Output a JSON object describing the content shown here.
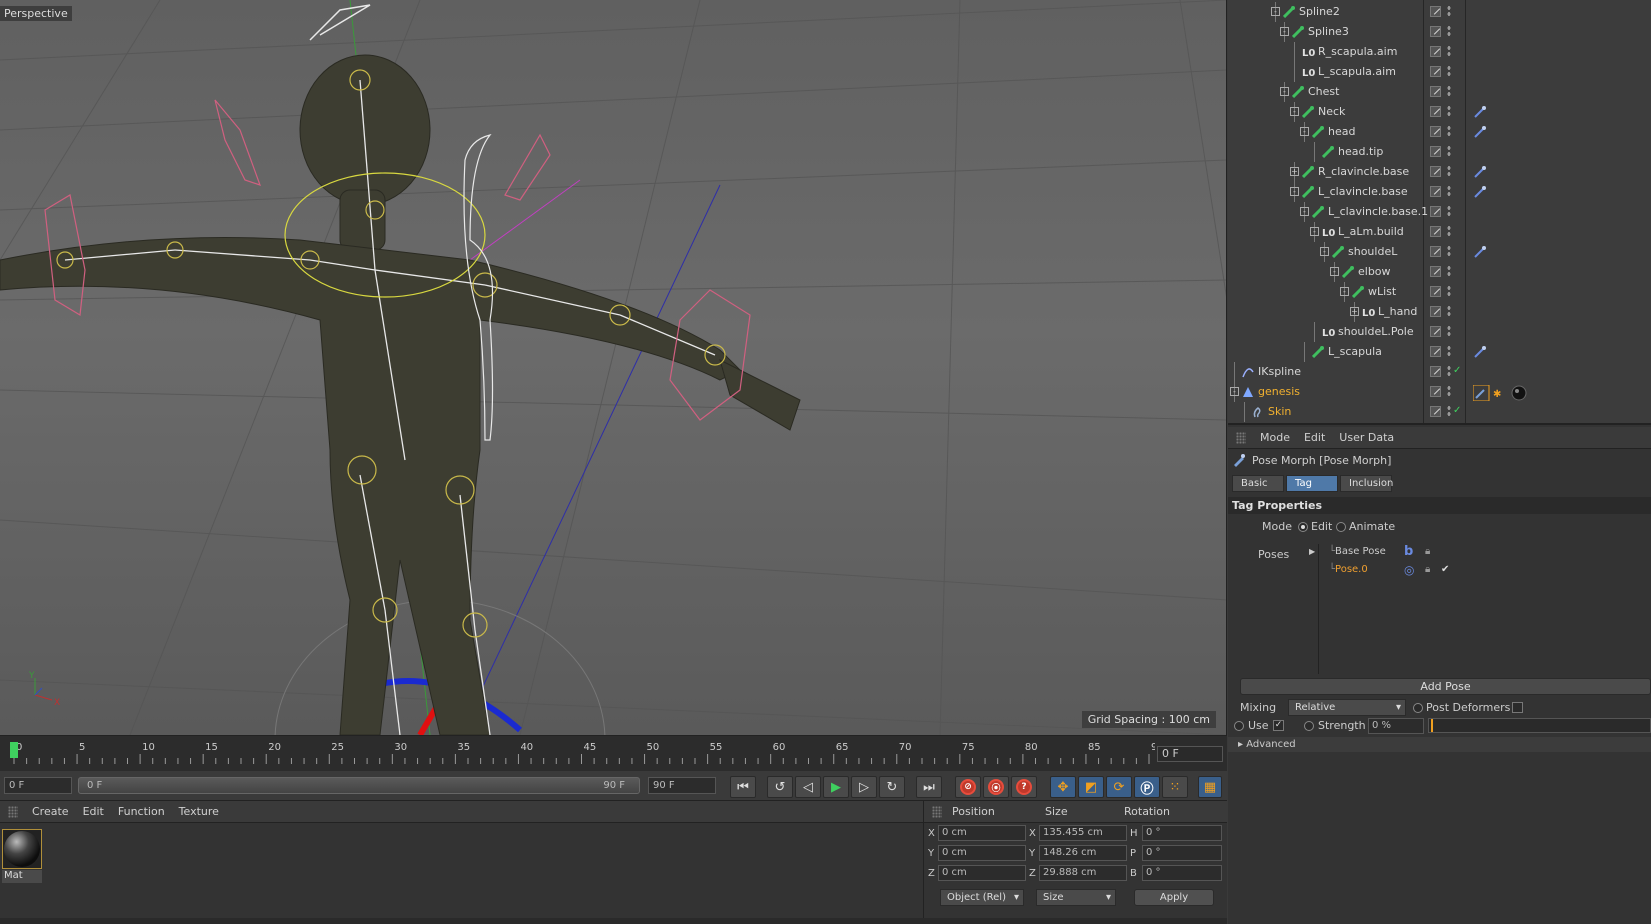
{
  "viewport": {
    "label": "Perspective",
    "grid_spacing": "Grid Spacing : 100 cm"
  },
  "timeline": {
    "ticks": [
      "0",
      "5",
      "10",
      "15",
      "20",
      "25",
      "30",
      "35",
      "40",
      "45",
      "50",
      "55",
      "60",
      "65",
      "70",
      "75",
      "80",
      "85",
      "90"
    ],
    "current_frame": "0 F"
  },
  "transport": {
    "start": "0 F",
    "range_start": "0 F",
    "range_end": "90 F",
    "end": "90 F"
  },
  "material_manager": {
    "menu": [
      "Create",
      "Edit",
      "Function",
      "Texture"
    ],
    "materials": [
      {
        "name": "Mat"
      }
    ]
  },
  "coordinates": {
    "headers": {
      "position": "Position",
      "size": "Size",
      "rotation": "Rotation"
    },
    "rows": [
      {
        "axis": "X",
        "pos": "0 cm",
        "size_axis": "X",
        "size": "135.455 cm",
        "rot_axis": "H",
        "rot": "0 °"
      },
      {
        "axis": "Y",
        "pos": "0 cm",
        "size_axis": "Y",
        "size": "148.26 cm",
        "rot_axis": "P",
        "rot": "0 °"
      },
      {
        "axis": "Z",
        "pos": "0 cm",
        "size_axis": "Z",
        "size": "29.888 cm",
        "rot_axis": "B",
        "rot": "0 °"
      }
    ],
    "mode": "Object (Rel)",
    "size_mode": "Size",
    "apply": "Apply"
  },
  "object_manager": {
    "items": [
      {
        "name": "Spline2",
        "icon": "bone",
        "expand": "-"
      },
      {
        "name": "Spline3",
        "icon": "bone",
        "expand": "-"
      },
      {
        "name": "R_scapula.aim",
        "icon": "null",
        "expand": ""
      },
      {
        "name": "L_scapula.aim",
        "icon": "null",
        "expand": ""
      },
      {
        "name": "Chest",
        "icon": "bone",
        "expand": "-"
      },
      {
        "name": "Neck",
        "icon": "bone",
        "expand": "-",
        "tag": "pose"
      },
      {
        "name": "head",
        "icon": "bone",
        "expand": "-",
        "tag": "pose"
      },
      {
        "name": "head.tip",
        "icon": "bone",
        "expand": ""
      },
      {
        "name": "R_clavincle.base",
        "icon": "bone",
        "expand": "+",
        "tag": "pose"
      },
      {
        "name": "L_clavincle.base",
        "icon": "bone",
        "expand": "-",
        "tag": "pose"
      },
      {
        "name": "L_clavincle.base.1",
        "icon": "bone",
        "expand": "-"
      },
      {
        "name": "L_aLm.build",
        "icon": "null",
        "expand": "-"
      },
      {
        "name": "shouldeL",
        "icon": "bone",
        "expand": "-",
        "tag": "pose"
      },
      {
        "name": "elbow",
        "icon": "bone",
        "expand": "-"
      },
      {
        "name": "wList",
        "icon": "bone",
        "expand": "-"
      },
      {
        "name": "L_hand",
        "icon": "null",
        "expand": "+"
      },
      {
        "name": "shouldeL.Pole",
        "icon": "null",
        "expand": ""
      },
      {
        "name": "L_scapula",
        "icon": "bone",
        "expand": "",
        "tag": "pose"
      },
      {
        "name": "IKspline",
        "icon": "spline",
        "expand": "",
        "check": "✓"
      },
      {
        "name": "genesis",
        "icon": "mesh",
        "expand": "-",
        "selected": true,
        "tag": "multi"
      },
      {
        "name": "Skin",
        "icon": "skin",
        "expand": "",
        "selected": true,
        "check": "✓"
      }
    ]
  },
  "attributes": {
    "menu": [
      "Mode",
      "Edit",
      "User Data"
    ],
    "title": "Pose Morph [Pose Morph]",
    "tabs": [
      {
        "label": "Basic",
        "active": false
      },
      {
        "label": "Tag",
        "active": true
      },
      {
        "label": "Inclusion",
        "active": false
      }
    ],
    "section": "Tag Properties",
    "mode_label": "Mode",
    "mode_edit": "Edit",
    "mode_animate": "Animate",
    "poses_label": "Poses",
    "poses": [
      {
        "name": "Base Pose",
        "active": false
      },
      {
        "name": "Pose.0",
        "active": true
      }
    ],
    "add_pose": "Add Pose",
    "mixing_label": "Mixing",
    "mixing_value": "Relative",
    "post_deformers": "Post Deformers",
    "use_label": "Use",
    "use_check": "✓",
    "strength_label": "Strength",
    "strength_value": "0 %",
    "strength_level": 0,
    "advanced": "Advanced"
  },
  "colors": {
    "accent": "#4f79a8",
    "selected_text": "#f0b030",
    "bone": "#3fbf5f"
  }
}
